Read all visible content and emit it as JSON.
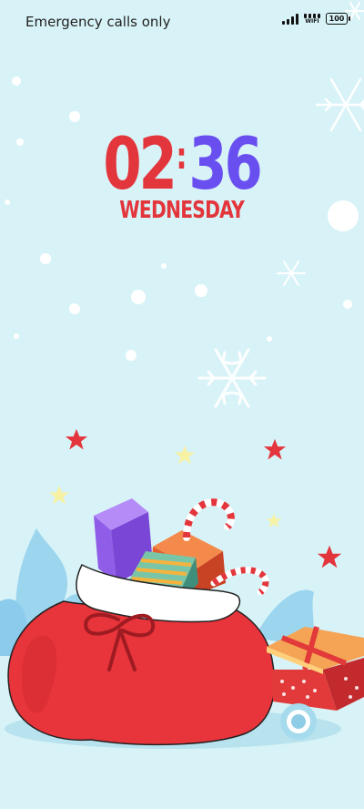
{
  "status_bar": {
    "carrier_text": "Emergency calls only",
    "wifi_label": "WIFI",
    "battery_level": "100"
  },
  "lockscreen": {
    "hours": "02",
    "separator": ":",
    "minutes": "36",
    "weekday": "WEDNESDAY"
  },
  "colors": {
    "background": "#d8f3f7",
    "clock_hours": "#e3353c",
    "clock_minutes": "#6a4ff0",
    "sack": "#e8343b"
  },
  "wallpaper": {
    "illustration": [
      "santa-sack",
      "gift-boxes",
      "candy-canes",
      "stars",
      "snowflakes",
      "ornament-ball"
    ]
  }
}
